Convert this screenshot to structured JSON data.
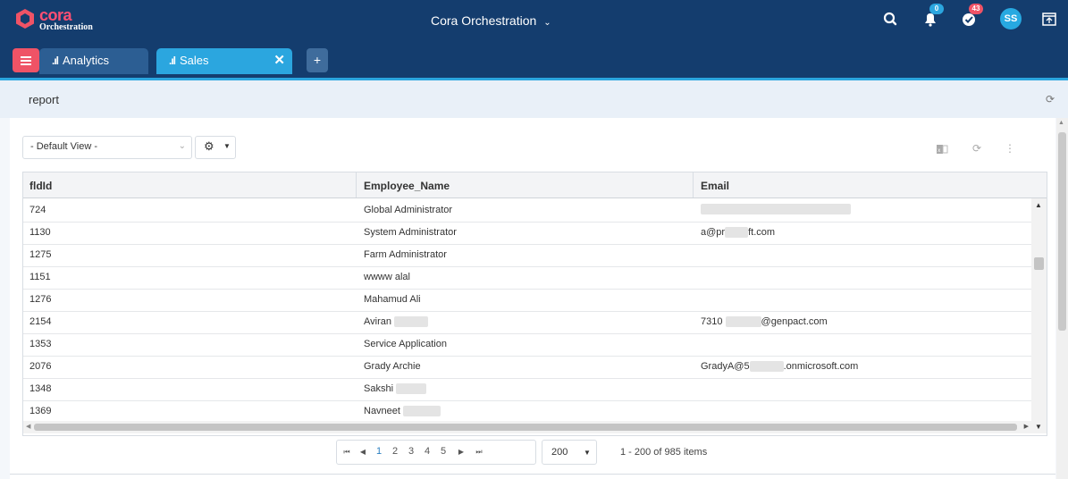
{
  "brand": {
    "word": "cora",
    "sub": "Orchestration"
  },
  "header": {
    "app_name": "Cora Orchestration",
    "notifications_count": "0",
    "tasks_count": "43",
    "user_initials": "SS"
  },
  "tabs": [
    {
      "label": "Analytics"
    },
    {
      "label": "Sales",
      "close": "✕"
    }
  ],
  "tab_add": "+",
  "report": {
    "title": "report"
  },
  "toolbar": {
    "view_select": "- Default View -"
  },
  "grid": {
    "columns": [
      "fldId",
      "Employee_Name",
      "Email"
    ],
    "rows": [
      {
        "id": "724",
        "name": "Global Administrator",
        "email": ""
      },
      {
        "id": "1130",
        "name": "System Administrator",
        "email_a": "a@pr",
        "email_b": "ft.com"
      },
      {
        "id": "1275",
        "name": "Farm Administrator",
        "email": ""
      },
      {
        "id": "1151",
        "name": "wwww alal",
        "email": ""
      },
      {
        "id": "1276",
        "name": "Mahamud Ali",
        "email": ""
      },
      {
        "id": "2154",
        "name": "Aviran",
        "email_a": "7310",
        "email_b": "@genpact.com"
      },
      {
        "id": "1353",
        "name": "Service Application",
        "email": ""
      },
      {
        "id": "2076",
        "name": "Grady Archie",
        "email_a": "GradyA@5",
        "email_b": ".onmicrosoft.com"
      },
      {
        "id": "1348",
        "name": "Sakshi",
        "email": ""
      },
      {
        "id": "1369",
        "name": "Navneet",
        "email": ""
      }
    ]
  },
  "pager": {
    "pages": [
      "1",
      "2",
      "3",
      "4",
      "5"
    ],
    "current_page": "1",
    "page_size": "200",
    "info": "1 - 200 of 985 items"
  }
}
